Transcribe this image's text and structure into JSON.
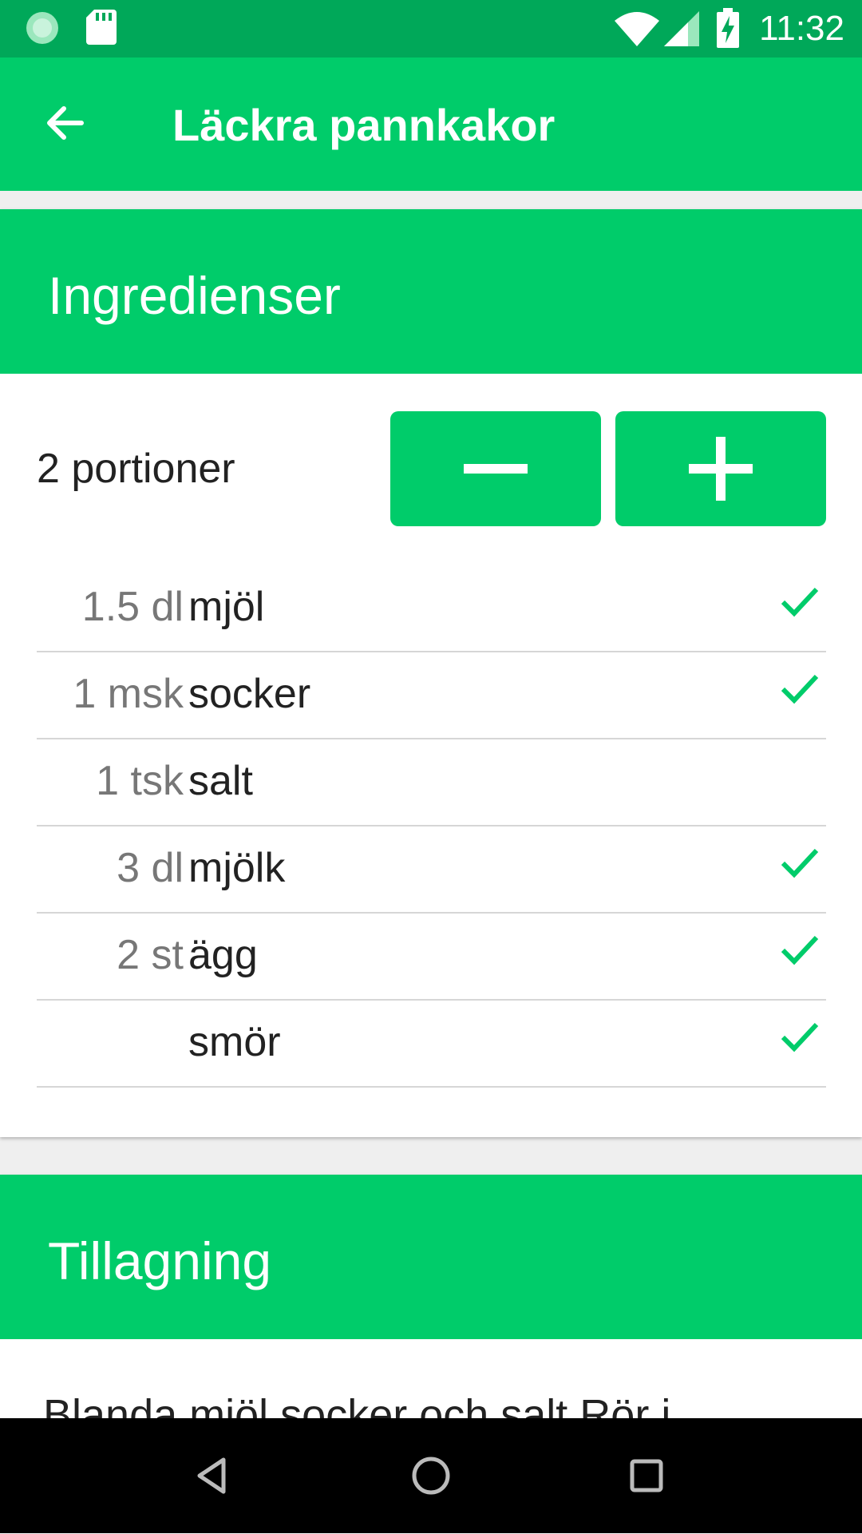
{
  "status_bar": {
    "time": "11:32",
    "icons": [
      "sync-icon",
      "sd-card-icon",
      "wifi-icon",
      "cell-signal-icon",
      "battery-charging-icon"
    ],
    "color": "#00a859"
  },
  "app_bar": {
    "title": "Läckra pannkakor",
    "back_icon": "arrow-back-icon",
    "color": "#00cc6a"
  },
  "ingredients_card": {
    "header": "Ingredienser",
    "portions": "2 portioner",
    "decrease_icon": "minus-icon",
    "increase_icon": "plus-icon",
    "items": [
      {
        "qty": "1.5 dl",
        "name": "mjöl",
        "checked": true
      },
      {
        "qty": "1 msk",
        "name": "socker",
        "checked": true
      },
      {
        "qty": "1 tsk",
        "name": "salt",
        "checked": false
      },
      {
        "qty": "3 dl",
        "name": "mjölk",
        "checked": true
      },
      {
        "qty": "2 st",
        "name": "ägg",
        "checked": true
      },
      {
        "qty": "",
        "name": "smör",
        "checked": true
      }
    ]
  },
  "preparation_card": {
    "header": "Tillagning",
    "text": "Blanda mjöl socker och salt Rör i"
  },
  "nav_bar": {
    "icons": [
      "back-triangle-icon",
      "home-circle-icon",
      "recents-square-icon"
    ]
  },
  "accent_color": "#00cc6a"
}
